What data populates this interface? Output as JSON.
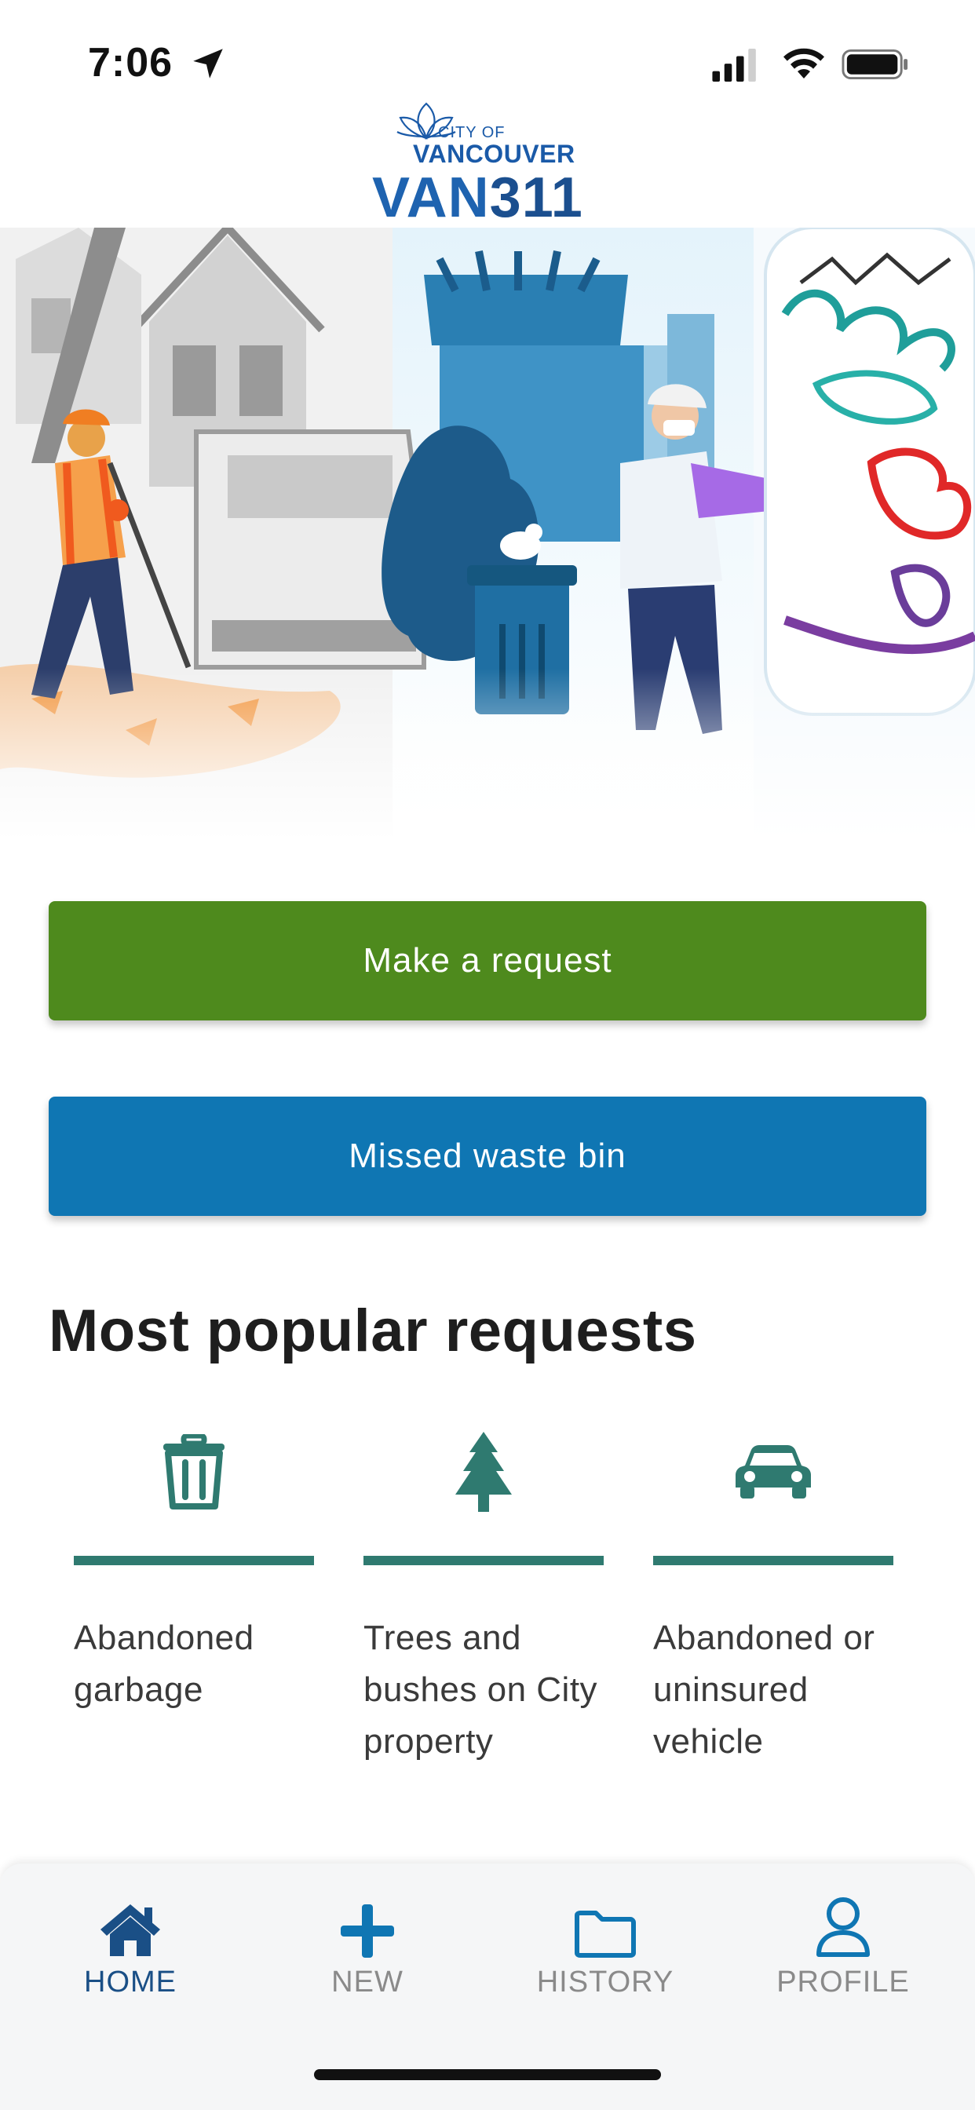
{
  "status_bar": {
    "time": "7:06"
  },
  "header": {
    "logo_city_of": "CITY OF",
    "logo_vancouver": "VANCOUVER",
    "logo_van": "VAN",
    "logo_311": "311"
  },
  "buttons": {
    "make_request": "Make a request",
    "missed_waste_bin": "Missed waste bin"
  },
  "popular": {
    "title": "Most popular requests",
    "items": [
      {
        "icon": "trash-icon",
        "label": "Abandoned garbage"
      },
      {
        "icon": "tree-icon",
        "label": "Trees and bushes on City property"
      },
      {
        "icon": "car-icon",
        "label": "Abandoned or uninsured vehicle"
      }
    ]
  },
  "nav": {
    "items": [
      {
        "icon": "home-icon",
        "label": "HOME",
        "active": true
      },
      {
        "icon": "plus-icon",
        "label": "NEW",
        "active": false
      },
      {
        "icon": "folder-icon",
        "label": "HISTORY",
        "active": false
      },
      {
        "icon": "profile-icon",
        "label": "PROFILE",
        "active": false
      }
    ]
  },
  "colors": {
    "request_button": "#4e8a1d",
    "waste_button": "#0f76b3",
    "accent_teal": "#2f7a70",
    "nav_active": "#1a4f86",
    "brand_blue": "#1e63b0"
  }
}
